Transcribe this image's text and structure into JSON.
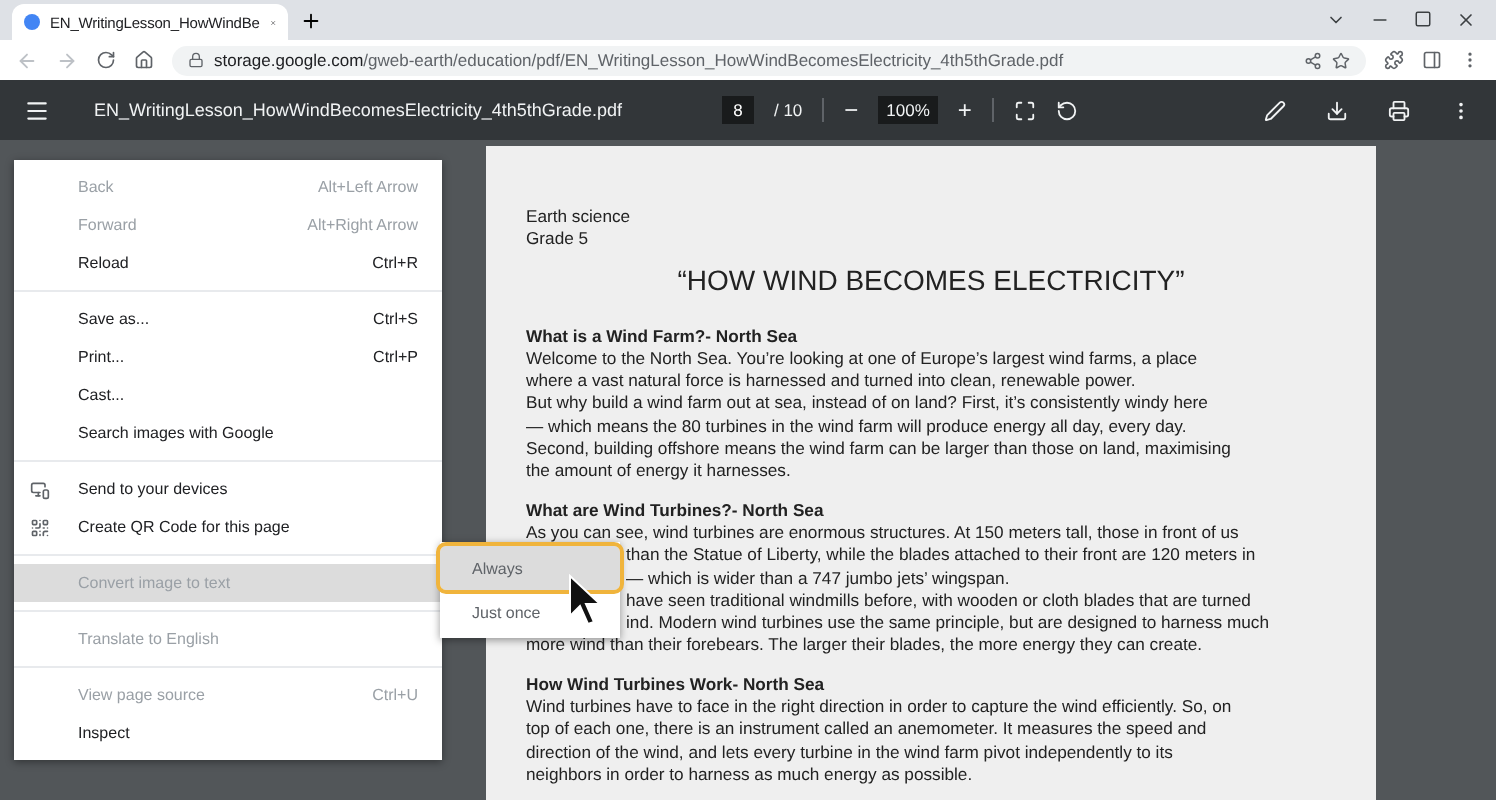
{
  "browser": {
    "tabs": [
      {
        "title": "EN_WritingLesson_HowWindBe",
        "selected": true
      }
    ],
    "address": {
      "host": "storage.google.com",
      "path": "/gweb-earth/education/pdf/EN_WritingLesson_HowWindBecomesElectricity_4th5thGrade.pdf"
    }
  },
  "pdf_toolbar": {
    "filename": "EN_WritingLesson_HowWindBecomesElectricity_4th5thGrade.pdf",
    "page": "8",
    "page_total": "/ 10",
    "zoom": "100%",
    "zoom_out": "−",
    "zoom_in": "+"
  },
  "document": {
    "lines": [
      {
        "kind": "meta",
        "text": "Earth science"
      },
      {
        "kind": "meta",
        "text": "Grade 5"
      },
      {
        "kind": "title",
        "text": "“HOW WIND BECOMES ELECTRICITY”"
      },
      {
        "kind": "heading",
        "text": "What is a Wind Farm?- North Sea"
      },
      {
        "kind": "body",
        "text": "Welcome to the North Sea. You’re looking at one of Europe’s largest wind farms, a place"
      },
      {
        "kind": "body",
        "text": "where a vast natural force is harnessed and turned into clean, renewable power."
      },
      {
        "kind": "body",
        "text": "But why build a wind farm out at sea, instead of on land? First, it’s consistently windy here"
      },
      {
        "kind": "body",
        "text": "— which means the 80 turbines in the wind farm will produce energy all day, every day."
      },
      {
        "kind": "body",
        "text": "Second, building offshore means the wind farm can be larger than those on land, maximising"
      },
      {
        "kind": "body",
        "text": "the amount of energy it harnesses."
      },
      {
        "kind": "heading",
        "text": "What are Wind Turbines?- North Sea"
      },
      {
        "kind": "body",
        "text": "As you can see, wind turbines are enormous structures. At 150 meters tall, those in front of us"
      },
      {
        "kind": "covered",
        "text": "than the Statue of Liberty, while the blades attached to their front are 120 meters in"
      },
      {
        "kind": "covered",
        "text": "— which is wider than a 747 jumbo jets’ wingspan."
      },
      {
        "kind": "covered",
        "text": "have seen traditional windmills before, with wooden or cloth blades that are turned"
      },
      {
        "kind": "covered",
        "text": "ind. Modern wind turbines use the same principle, but are designed to harness much"
      },
      {
        "kind": "body",
        "text": "more wind than their forebears. The larger their blades, the more energy they can create."
      },
      {
        "kind": "heading",
        "text": "How Wind Turbines Work- North Sea"
      },
      {
        "kind": "body",
        "text": "Wind turbines have to face in the right direction in order to capture the wind efficiently. So, on"
      },
      {
        "kind": "body",
        "text": "top of each one, there is an instrument called an anemometer. It measures the speed and"
      },
      {
        "kind": "body",
        "text": "direction of the wind, and lets every turbine in the wind farm pivot independently to its"
      },
      {
        "kind": "body",
        "text": "neighbors in order to harness as much energy as possible."
      }
    ]
  },
  "context_menu": {
    "groups": [
      [
        {
          "label": "Back",
          "shortcut": "Alt+Left Arrow",
          "disabled": true,
          "selected": false,
          "kind": "plain"
        },
        {
          "label": "Forward",
          "shortcut": "Alt+Right Arrow",
          "disabled": true,
          "selected": false,
          "kind": "plain"
        },
        {
          "label": "Reload",
          "shortcut": "Ctrl+R",
          "disabled": false,
          "selected": false,
          "kind": "plain"
        }
      ],
      [
        {
          "label": "Save as...",
          "shortcut": "Ctrl+S",
          "disabled": false,
          "selected": false,
          "kind": "plain"
        },
        {
          "label": "Print...",
          "shortcut": "Ctrl+P",
          "disabled": false,
          "selected": false,
          "kind": "plain"
        },
        {
          "label": "Cast...",
          "disabled": false,
          "selected": false,
          "kind": "plain"
        },
        {
          "label": "Search images with Google",
          "disabled": false,
          "selected": false,
          "kind": "plain"
        }
      ],
      [
        {
          "label": "Send to your devices",
          "disabled": false,
          "selected": false,
          "kind": "devices"
        },
        {
          "label": "Create QR Code for this page",
          "disabled": false,
          "selected": false,
          "kind": "qr"
        }
      ],
      [
        {
          "label": "Convert image to text",
          "disabled": true,
          "selected": true,
          "kind": "plain"
        }
      ],
      [
        {
          "label": "Translate to English",
          "disabled": true,
          "selected": false,
          "kind": "plain"
        }
      ],
      [
        {
          "label": "View page source",
          "shortcut": "Ctrl+U",
          "disabled": true,
          "selected": false,
          "kind": "plain"
        },
        {
          "label": "Inspect",
          "disabled": false,
          "selected": false,
          "kind": "plain"
        }
      ]
    ]
  },
  "submenu": {
    "items": [
      {
        "label": "Always",
        "selected": true
      },
      {
        "label": "Just once",
        "selected": false
      }
    ]
  }
}
